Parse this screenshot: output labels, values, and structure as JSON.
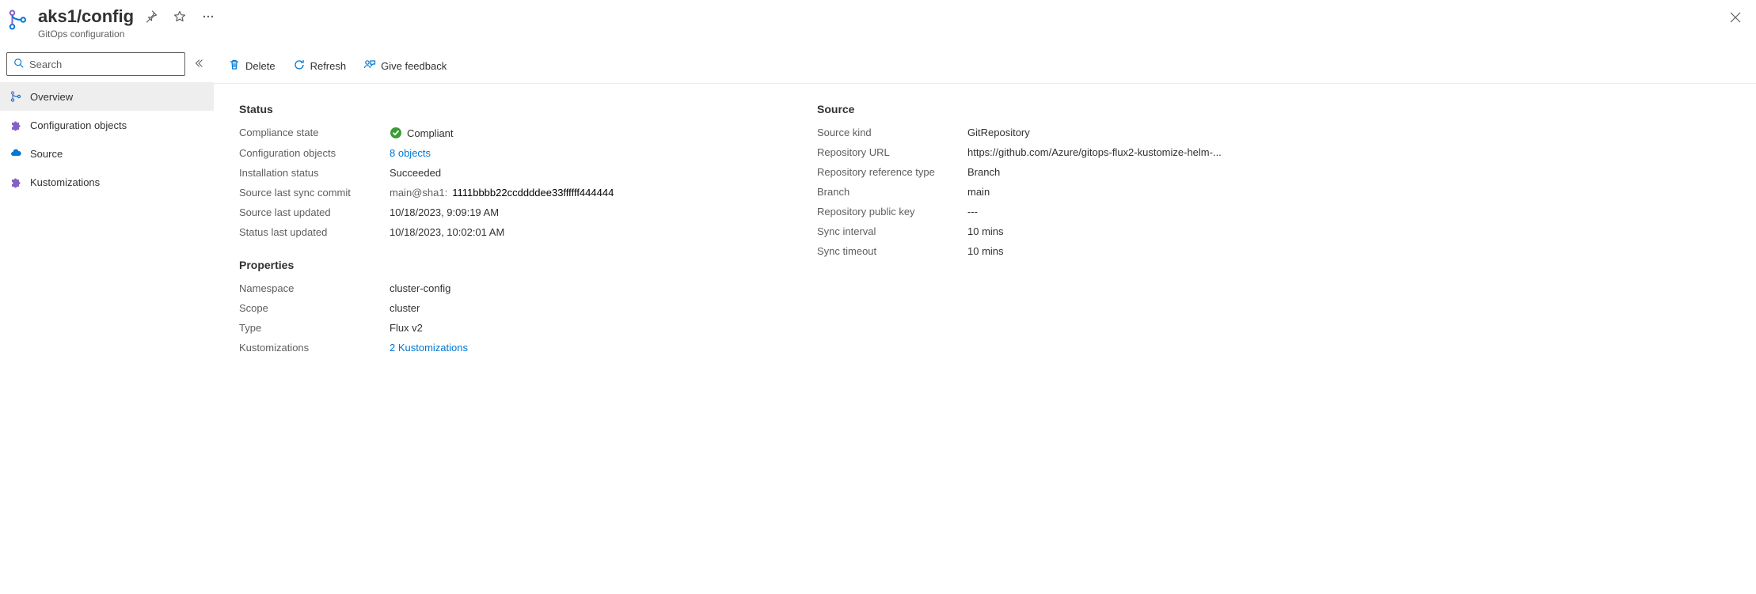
{
  "header": {
    "title": "aks1/config",
    "subtitle": "GitOps configuration",
    "pin_title": "Pin",
    "fav_title": "Favorite",
    "more_title": "More",
    "close_title": "Close"
  },
  "search": {
    "placeholder": "Search"
  },
  "nav": {
    "items": [
      {
        "label": "Overview",
        "icon": "gitops"
      },
      {
        "label": "Configuration objects",
        "icon": "puzzle"
      },
      {
        "label": "Source",
        "icon": "cloud"
      },
      {
        "label": "Kustomizations",
        "icon": "puzzle"
      }
    ]
  },
  "toolbar": {
    "delete_label": "Delete",
    "refresh_label": "Refresh",
    "feedback_label": "Give feedback"
  },
  "status": {
    "heading": "Status",
    "compliance_key": "Compliance state",
    "compliance_val": "Compliant",
    "config_objects_key": "Configuration objects",
    "config_objects_val": "8 objects",
    "install_status_key": "Installation status",
    "install_status_val": "Succeeded",
    "src_commit_key": "Source last sync commit",
    "src_commit_prefix": "main@sha1:",
    "src_commit_hash": "1111bbbb22ccddddee33ffffff444444",
    "src_updated_key": "Source last updated",
    "src_updated_val": "10/18/2023, 9:09:19 AM",
    "status_updated_key": "Status last updated",
    "status_updated_val": "10/18/2023, 10:02:01 AM"
  },
  "properties": {
    "heading": "Properties",
    "namespace_key": "Namespace",
    "namespace_val": "cluster-config",
    "scope_key": "Scope",
    "scope_val": "cluster",
    "type_key": "Type",
    "type_val": "Flux v2",
    "kustom_key": "Kustomizations",
    "kustom_val": "2 Kustomizations"
  },
  "source": {
    "heading": "Source",
    "kind_key": "Source kind",
    "kind_val": "GitRepository",
    "url_key": "Repository URL",
    "url_val": "https://github.com/Azure/gitops-flux2-kustomize-helm-...",
    "ref_type_key": "Repository reference type",
    "ref_type_val": "Branch",
    "branch_key": "Branch",
    "branch_val": "main",
    "pubkey_key": "Repository public key",
    "pubkey_val": "---",
    "sync_interval_key": "Sync interval",
    "sync_interval_val": "10 mins",
    "sync_timeout_key": "Sync timeout",
    "sync_timeout_val": "10 mins"
  }
}
